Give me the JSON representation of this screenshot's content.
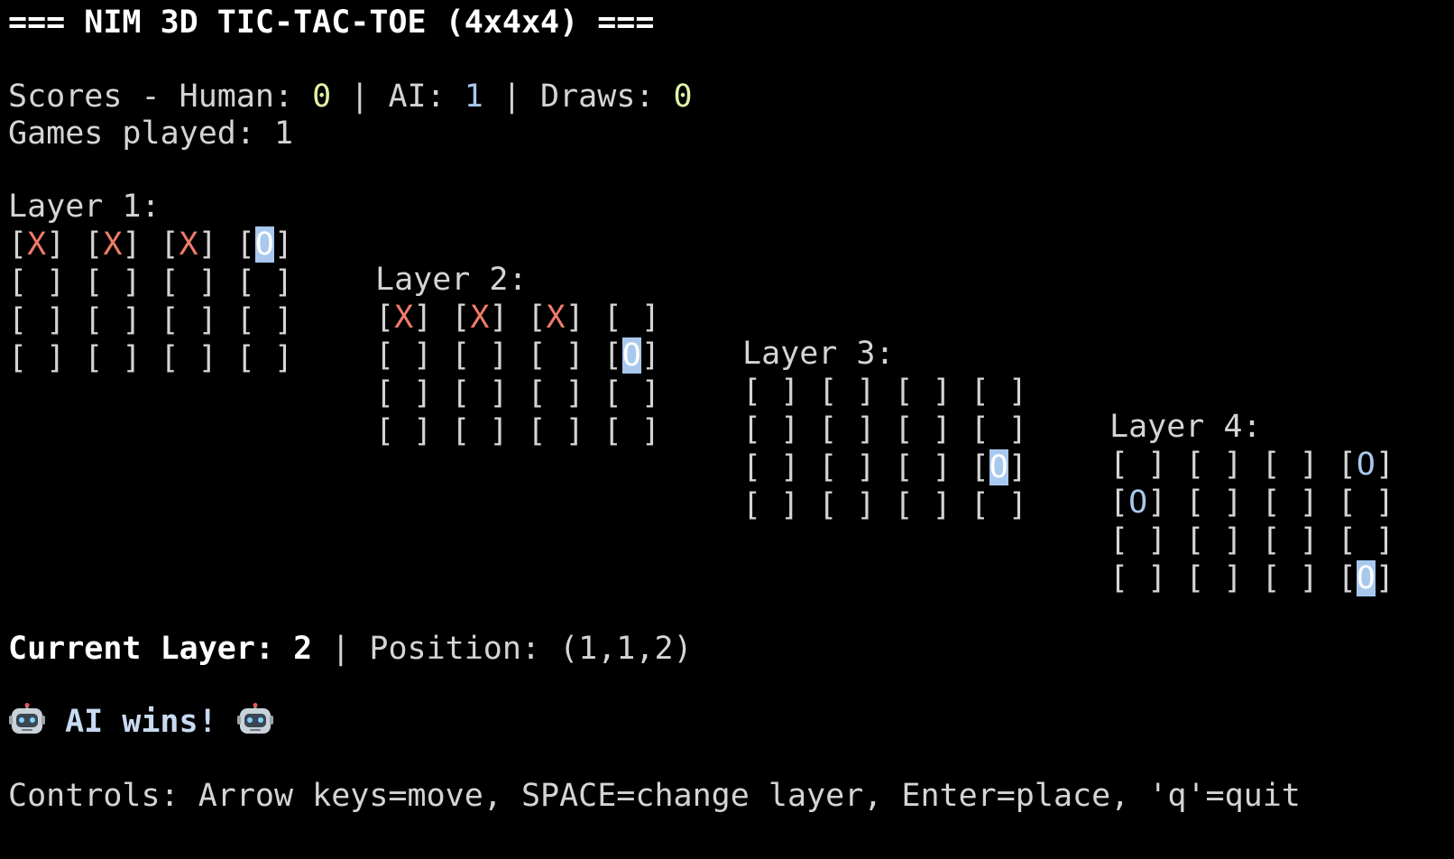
{
  "header": {
    "title": "=== NIM 3D TIC-TAC-TOE (4x4x4) ==="
  },
  "scores": {
    "prefix": "Scores - Human: ",
    "human": "0",
    "sep1": " | AI: ",
    "ai": "1",
    "sep2": " | Draws: ",
    "draws": "0"
  },
  "games": {
    "label": "Games played: ",
    "count": "1"
  },
  "layers": [
    {
      "label": "Layer 1:",
      "rows": [
        [
          "X",
          "X",
          "X",
          "O"
        ],
        [
          " ",
          " ",
          " ",
          " "
        ],
        [
          " ",
          " ",
          " ",
          " "
        ],
        [
          " ",
          " ",
          " ",
          " "
        ]
      ],
      "highlight": [
        [
          0,
          3
        ]
      ]
    },
    {
      "label": "Layer 2:",
      "rows": [
        [
          "X",
          "X",
          "X",
          " "
        ],
        [
          " ",
          " ",
          " ",
          "O"
        ],
        [
          " ",
          " ",
          " ",
          " "
        ],
        [
          " ",
          " ",
          " ",
          " "
        ]
      ],
      "highlight": [
        [
          1,
          3
        ]
      ]
    },
    {
      "label": "Layer 3:",
      "rows": [
        [
          " ",
          " ",
          " ",
          " "
        ],
        [
          " ",
          " ",
          " ",
          " "
        ],
        [
          " ",
          " ",
          " ",
          "O"
        ],
        [
          " ",
          " ",
          " ",
          " "
        ]
      ],
      "highlight": [
        [
          2,
          3
        ]
      ]
    },
    {
      "label": "Layer 4:",
      "rows": [
        [
          " ",
          " ",
          " ",
          "O"
        ],
        [
          "O",
          " ",
          " ",
          " "
        ],
        [
          " ",
          " ",
          " ",
          " "
        ],
        [
          " ",
          " ",
          " ",
          "O"
        ]
      ],
      "highlight": [
        [
          3,
          3
        ]
      ]
    }
  ],
  "status": {
    "current_label": "Current Layer: 2",
    "position": " | Position: (1,1,2)"
  },
  "result": {
    "text": " AI wins! ",
    "icon": "robot-icon"
  },
  "controls": {
    "text": "Controls: Arrow keys=move, SPACE=change layer, Enter=place, 'q'=quit"
  },
  "colors": {
    "background": "#000000",
    "text": "#d4d4d4",
    "x_mark": "#f07b6a",
    "o_mark": "#a8c8ee",
    "score_green": "#dff2a8"
  }
}
